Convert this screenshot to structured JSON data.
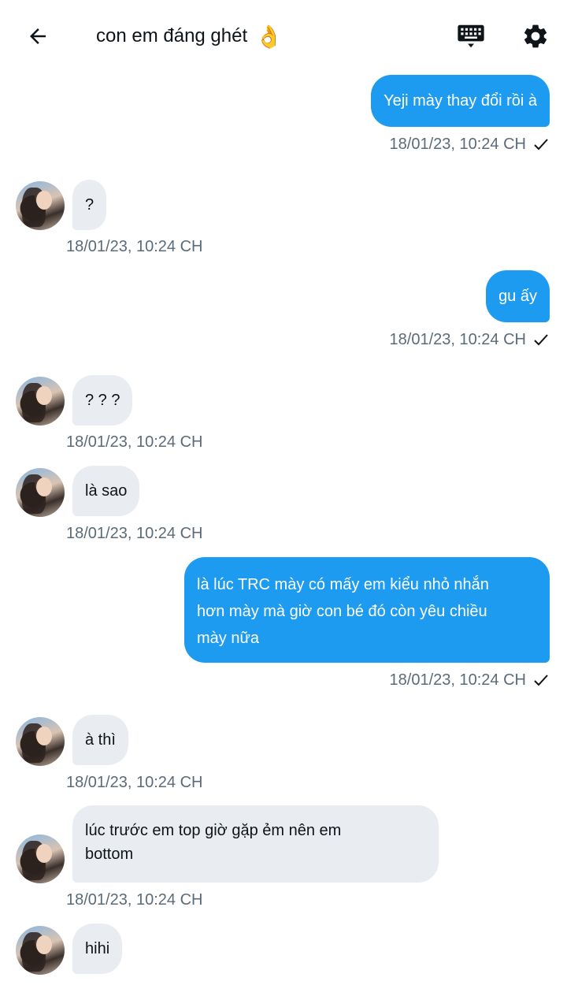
{
  "header": {
    "title": "con em đáng ghét",
    "title_emoji": "👌",
    "back_icon": "arrow-left-icon",
    "keyboard_icon": "keyboard-icon",
    "settings_icon": "gear-icon"
  },
  "colors": {
    "outgoing_bubble": "#1d9bf0",
    "incoming_bubble": "#e9edf1",
    "timestamp": "#5b6b7a"
  },
  "messages": [
    {
      "direction": "out",
      "text": "Yeji mày thay đổi rồi à",
      "time": "18/01/23,  10:24 CH",
      "read_check": true
    },
    {
      "direction": "in",
      "text": "?",
      "time": "18/01/23,  10:24 CH"
    },
    {
      "direction": "out",
      "text": "gu ấy",
      "time": "18/01/23,  10:24 CH",
      "read_check": true
    },
    {
      "direction": "in",
      "text": "? ? ?",
      "time": "18/01/23,  10:24 CH"
    },
    {
      "direction": "in",
      "text": "là sao",
      "time": "18/01/23,  10:24 CH"
    },
    {
      "direction": "out",
      "text_lines": [
        "là lúc TRC mày có mấy em kiểu nhỏ nhắn",
        "hơn mày mà giờ con bé đó còn yêu chiều",
        "mày nữa"
      ],
      "time": "18/01/23,  10:24 CH",
      "read_check": true
    },
    {
      "direction": "in",
      "text": "à thì",
      "time": "18/01/23,  10:24 CH"
    },
    {
      "direction": "in",
      "text_lines": [
        "lúc trước em top giờ gặp ẻm nên em",
        "bottom"
      ],
      "time": "18/01/23,  10:24 CH"
    },
    {
      "direction": "in",
      "text": "hihi"
    }
  ]
}
